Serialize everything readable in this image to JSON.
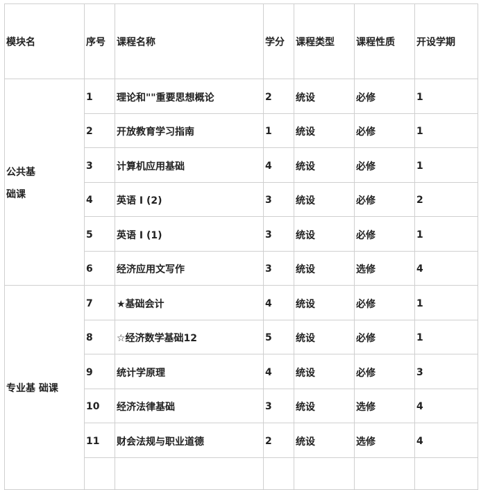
{
  "headers": [
    "模块名",
    "序号",
    "课程名称",
    "学分",
    "课程类型",
    "课程性质",
    "开设学期"
  ],
  "modules": [
    {
      "name": "公共基础课",
      "name_line1": "公共基",
      "name_line2": "础课"
    },
    {
      "name": "专业基 础课"
    }
  ],
  "rows": [
    {
      "no": "1",
      "name": "理论和\"\"重要思想概论",
      "credit": "2",
      "type": "统设",
      "nature": "必修",
      "term": "1"
    },
    {
      "no": "2",
      "name": "开放教育学习指南",
      "credit": "1",
      "type": "统设",
      "nature": "必修",
      "term": "1"
    },
    {
      "no": "3",
      "name": "计算机应用基础",
      "credit": "4",
      "type": "统设",
      "nature": "必修",
      "term": "1"
    },
    {
      "no": "4",
      "name": "英语 I (2)",
      "credit": "3",
      "type": "统设",
      "nature": "必修",
      "term": "2"
    },
    {
      "no": "5",
      "name": "英语 I (1)",
      "credit": "3",
      "type": "统设",
      "nature": "必修",
      "term": "1"
    },
    {
      "no": "6",
      "name": "经济应用文写作",
      "credit": "3",
      "type": "统设",
      "nature": "选修",
      "term": "4"
    },
    {
      "no": "7",
      "name": "★基础会计",
      "credit": "4",
      "type": "统设",
      "nature": "必修",
      "term": "1"
    },
    {
      "no": "8",
      "name": "☆经济数学基础12",
      "credit": "5",
      "type": "统设",
      "nature": "必修",
      "term": "1"
    },
    {
      "no": "9",
      "name": "统计学原理",
      "credit": "4",
      "type": "统设",
      "nature": "必修",
      "term": "3"
    },
    {
      "no": "10",
      "name": "经济法律基础",
      "credit": "3",
      "type": "统设",
      "nature": "选修",
      "term": "4"
    },
    {
      "no": "11",
      "name": "财会法规与职业道德",
      "credit": "2",
      "type": "统设",
      "nature": "选修",
      "term": "4"
    }
  ]
}
